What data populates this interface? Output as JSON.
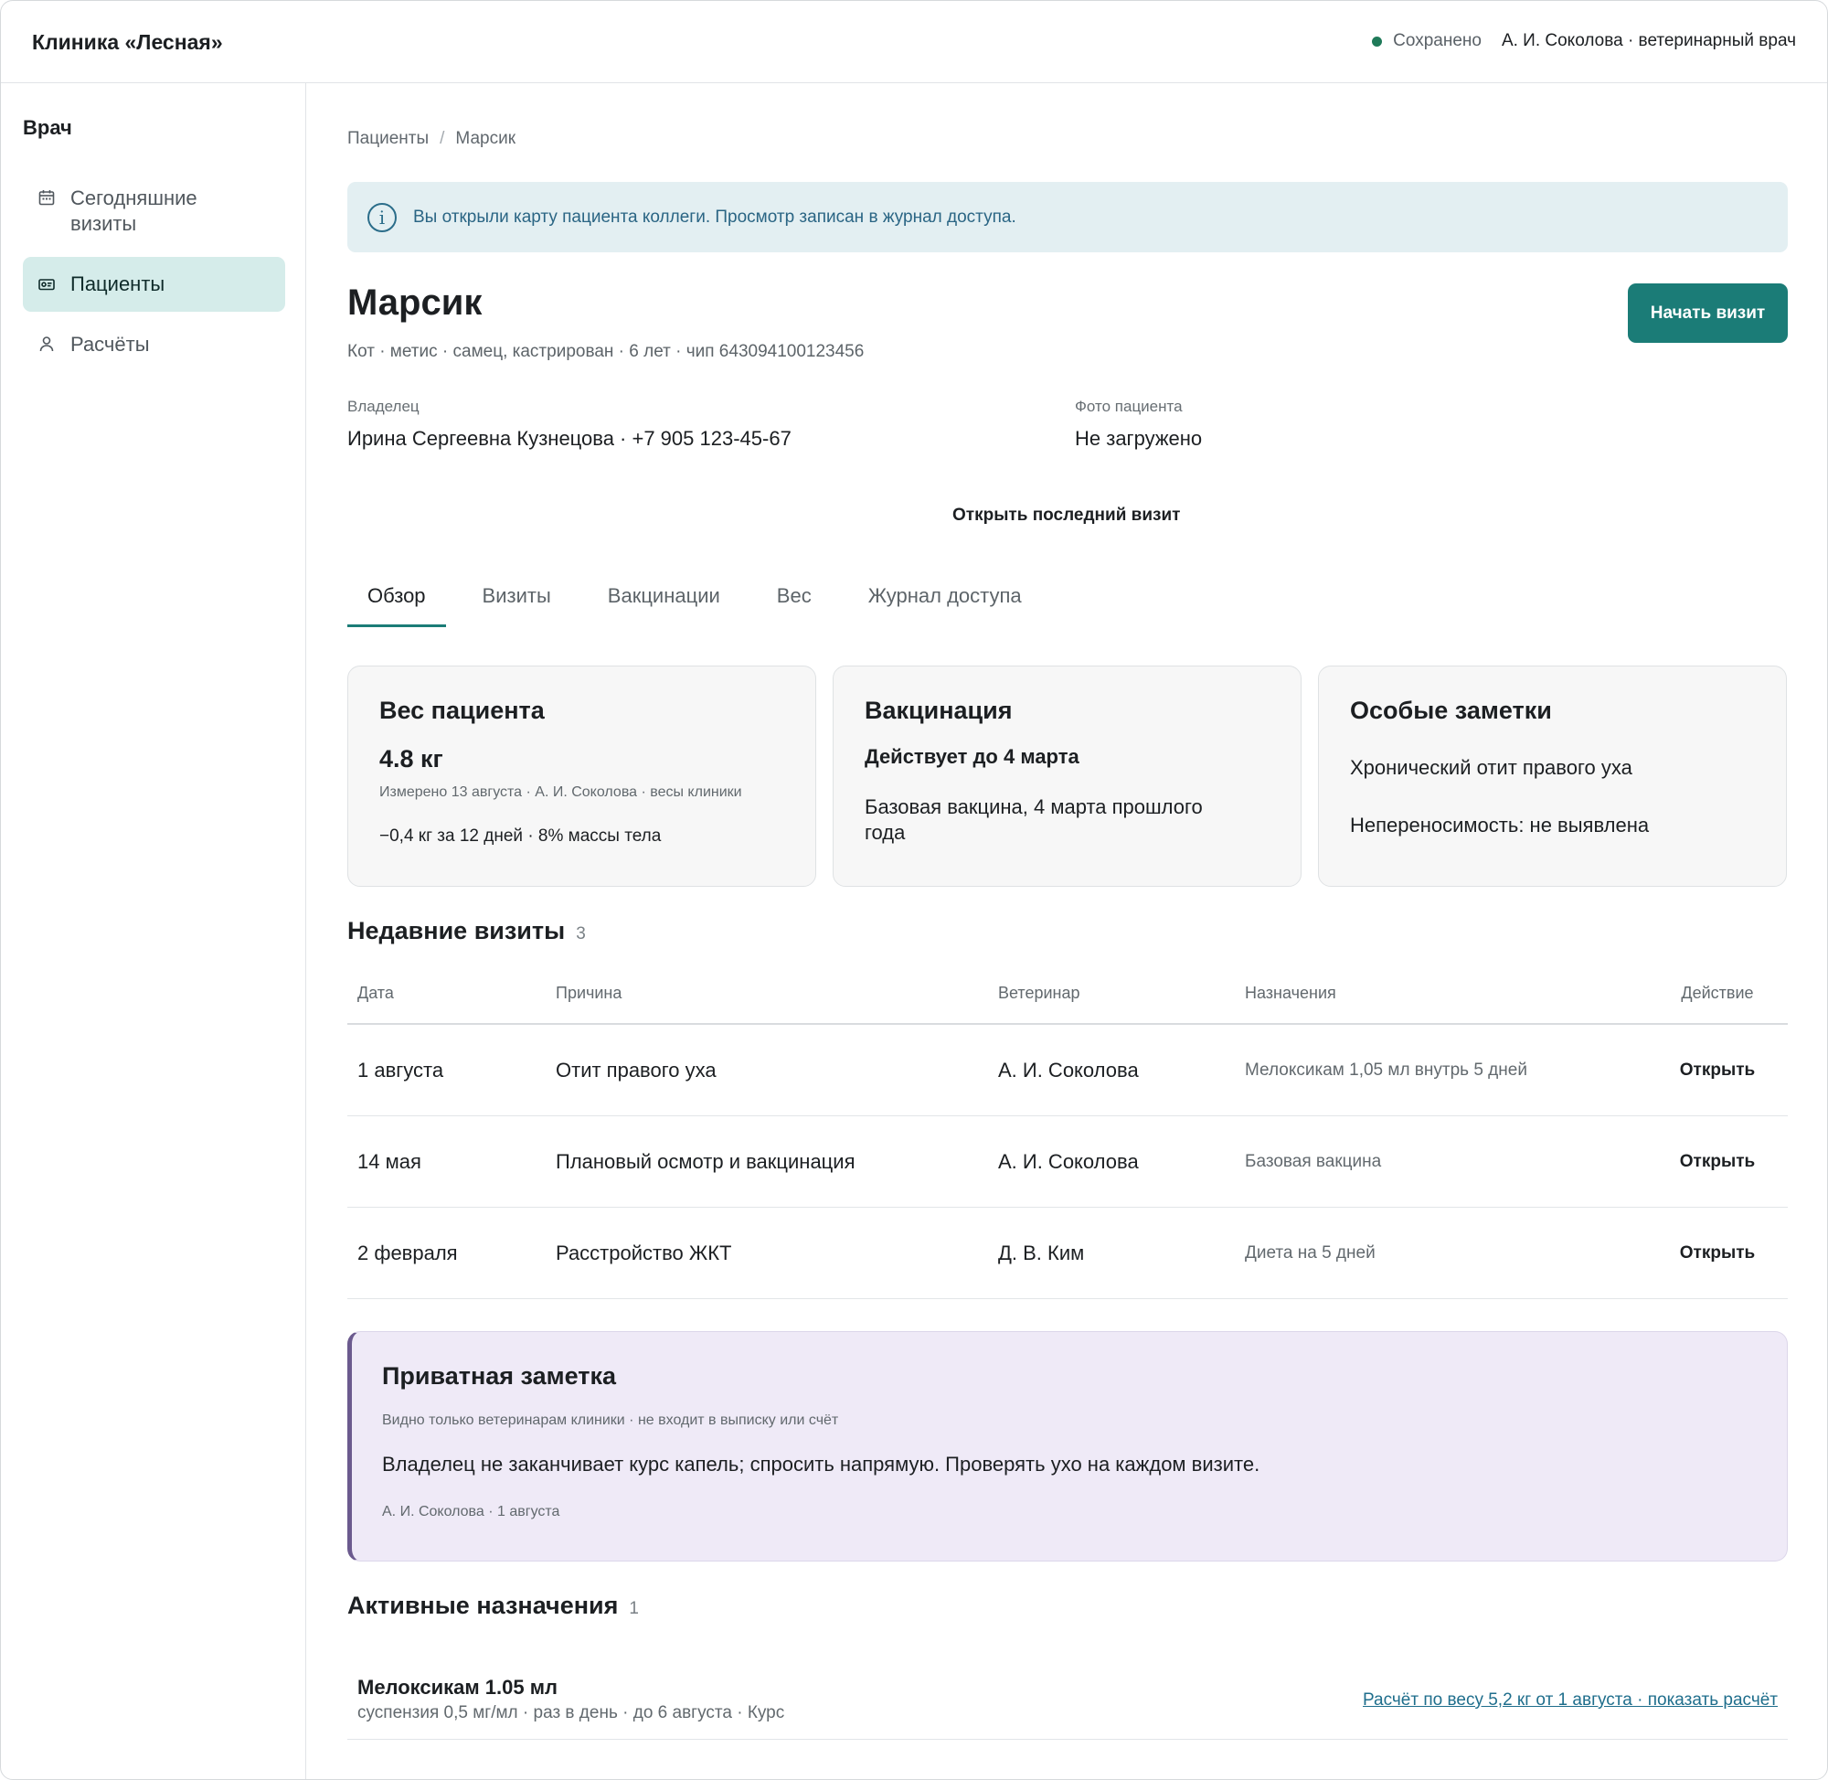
{
  "header": {
    "brand": "Клиника «Лесная»",
    "save_status": "Сохранено",
    "user": "А. И. Соколова · ветеринарный врач",
    "colors": {
      "saved_dot": "#1f7a59"
    }
  },
  "sidebar": {
    "title": "Врач",
    "items": [
      {
        "label": "Сегодняшние визиты",
        "icon": "calendar-icon",
        "active": false
      },
      {
        "label": "Пациенты",
        "icon": "id-card-icon",
        "active": true
      },
      {
        "label": "Расчёты",
        "icon": "user-icon",
        "active": false
      }
    ]
  },
  "breadcrumb": {
    "root": "Пациенты",
    "separator": "/",
    "current": "Марсик"
  },
  "banner": {
    "icon": "info-icon",
    "text": "Вы открыли карту пациента коллеги. Просмотр записан в журнал доступа."
  },
  "patient": {
    "name": "Марсик",
    "meta": "Кот · метис · самец, кастрирован · 6 лет · чип 643094100123456",
    "start_visit": "Начать визит",
    "owner_label": "Владелец",
    "owner_value": "Ирина Сергеевна Кузнецова · +7 905 123-45-67",
    "photo_label": "Фото пациента",
    "photo_value": "Не загружено",
    "open_last_visit": "Открыть последний визит"
  },
  "tabs": [
    {
      "label": "Обзор",
      "active": true
    },
    {
      "label": "Визиты",
      "active": false
    },
    {
      "label": "Вакцинации",
      "active": false
    },
    {
      "label": "Вес",
      "active": false
    },
    {
      "label": "Журнал доступа",
      "active": false
    }
  ],
  "cards": {
    "weight": {
      "title": "Вес пациента",
      "value": "4.8 кг",
      "measured": "Измерено 13 августа · А. И. Соколова · весы клиники",
      "change": "−0,4 кг за 12 дней · 8% массы тела"
    },
    "vaccine": {
      "title": "Вакцинация",
      "status": "Действует до 4 марта",
      "detail": "Базовая вакцина, 4 марта прошлого года"
    },
    "notes": {
      "title": "Особые заметки",
      "line1": "Хронический отит правого уха",
      "line2": "Непереносимость: не выявлена"
    }
  },
  "visits": {
    "title": "Недавние визиты",
    "count": "3",
    "columns": [
      "Дата",
      "Причина",
      "Ветеринар",
      "Назначения",
      "Действие"
    ],
    "rows": [
      {
        "date": "1 августа",
        "reason": "Отит правого уха",
        "vet": "А. И. Соколова",
        "rx": "Мелоксикам 1,05 мл внутрь 5 дней",
        "action": "Открыть"
      },
      {
        "date": "14 мая",
        "reason": "Плановый осмотр и вакцинация",
        "vet": "А. И. Соколова",
        "rx": "Базовая вакцина",
        "action": "Открыть"
      },
      {
        "date": "2 февраля",
        "reason": "Расстройство ЖКТ",
        "vet": "Д. В. Ким",
        "rx": "Диета на 5 дней",
        "action": "Открыть"
      }
    ]
  },
  "private_note": {
    "title": "Приватная заметка",
    "subtitle": "Видно только ветеринарам клиники · не входит в выписку или счёт",
    "body": "Владелец не заканчивает курс капель; спросить напрямую. Проверять ухо на каждом визите.",
    "footer": "А. И. Соколова · 1 августа"
  },
  "prescriptions": {
    "title": "Активные назначения",
    "count": "1",
    "items": [
      {
        "name": "Мелоксикам 1.05 мл",
        "detail": "суспензия 0,5 мг/мл · раз в день · до 6 августа · Курс",
        "calc_link": "Расчёт по весу 5,2 кг от 1 августа · показать расчёт"
      }
    ]
  }
}
